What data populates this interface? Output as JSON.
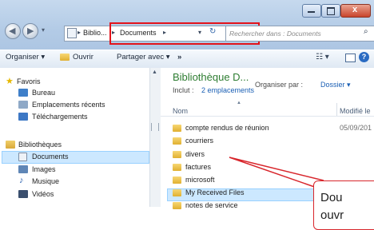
{
  "window": {
    "breadcrumb_1": "Biblio...",
    "breadcrumb_2": "Documents",
    "search_placeholder": "Rechercher dans : Documents"
  },
  "toolbar": {
    "organiser": "Organiser ▾",
    "ouvrir": "Ouvrir",
    "partager": "Partager avec ▾",
    "more": "»"
  },
  "nav": {
    "favoris": "Favoris",
    "bureau": "Bureau",
    "emplacements_recents": "Emplacements récents",
    "telechargements": "Téléchargements",
    "bibliotheques": "Bibliothèques",
    "documents": "Documents",
    "images": "Images",
    "musique": "Musique",
    "videos": "Vidéos"
  },
  "library": {
    "title": "Bibliothèque D...",
    "includes_prefix": "Inclut :",
    "includes_link": "2 emplacements",
    "arrange_label": "Organiser par :",
    "arrange_value": "Dossier ▾"
  },
  "columns": {
    "name": "Nom",
    "modified": "Modifié le"
  },
  "files": [
    {
      "name": "compte rendus de réunion",
      "date": "05/09/201"
    },
    {
      "name": "courriers",
      "date": ""
    },
    {
      "name": "divers",
      "date": ""
    },
    {
      "name": "factures",
      "date": ""
    },
    {
      "name": "microsoft",
      "date": ""
    },
    {
      "name": "My Received Files",
      "date": ""
    },
    {
      "name": "notes de service",
      "date": ""
    }
  ],
  "callout": {
    "line1": "Dou",
    "line2": "ouvr"
  },
  "colors": {
    "highlight": "#e3131b",
    "selection": "#cce8ff",
    "link": "#1a5fb4",
    "title": "#2e7d32"
  }
}
